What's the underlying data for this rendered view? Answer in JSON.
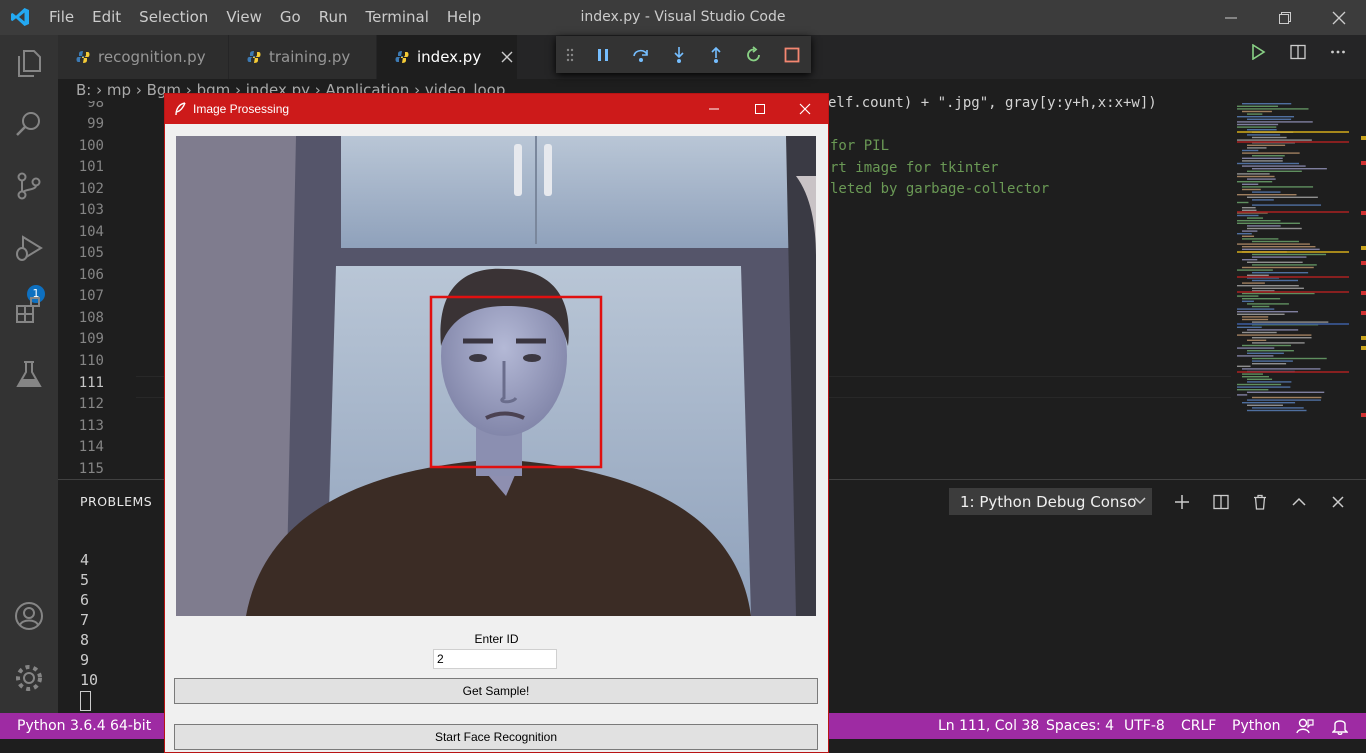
{
  "window": {
    "title": "index.py - Visual Studio Code"
  },
  "menu": [
    "File",
    "Edit",
    "Selection",
    "View",
    "Go",
    "Run",
    "Terminal",
    "Help"
  ],
  "tabs": [
    {
      "label": "recognition.py"
    },
    {
      "label": "training.py"
    },
    {
      "label": "index.py"
    }
  ],
  "breadcrumb": [
    "B:",
    "mp",
    "Bgm",
    "bgm",
    "index.py",
    "Application",
    "video_loop"
  ],
  "line_numbers": [
    "98",
    "99",
    "100",
    "101",
    "102",
    "103",
    "104",
    "105",
    "106",
    "107",
    "108",
    "109",
    "110",
    "111",
    "112",
    "113",
    "114",
    "115"
  ],
  "code": {
    "line98": "elf.count) + \".jpg\", gray[y:y+h,x:x+w])",
    "line100": "for PIL",
    "line101": "rt image for tkinter",
    "line102": "leted by garbage-collector"
  },
  "debug_badge": "1",
  "panel": {
    "problems_label": "PROBLEMS",
    "console_select": "1: Python Debug Conso",
    "terminal_lines": [
      "4",
      "5",
      "6",
      "7",
      "8",
      "9",
      "10"
    ]
  },
  "status": {
    "python": "Python 3.6.4 64-bit",
    "position": "Ln 111, Col 38",
    "spaces": "Spaces: 4",
    "encoding": "UTF-8",
    "eol": "CRLF",
    "language": "Python"
  },
  "tk": {
    "title": "Image Prosessing",
    "enter_id_label": "Enter ID",
    "id_value": "2",
    "get_sample_button": "Get Sample!",
    "start_recognition_button": "Start Face Recognition"
  },
  "colors": {
    "statusbar": "#9e2ba3",
    "tk_titlebar": "#cd1a1a",
    "face_box": "#e01010"
  }
}
